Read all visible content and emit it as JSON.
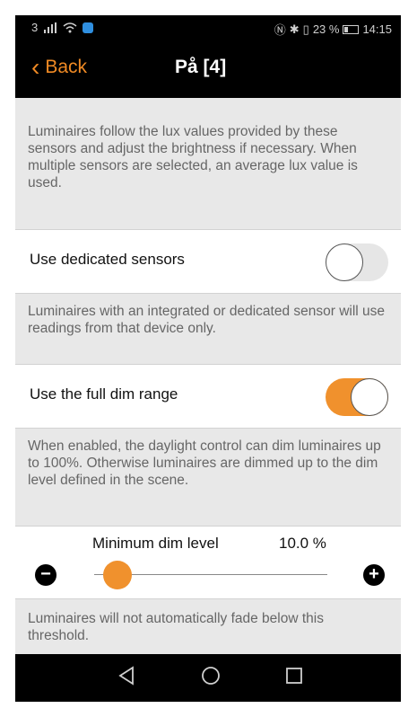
{
  "status": {
    "carrier": "3",
    "battery_text": "23 %",
    "time": "14:15"
  },
  "nav": {
    "back_label": "Back",
    "title": "På [4]"
  },
  "sensors_description": "Luminaires follow the lux values provided by these sensors and adjust the brightness if necessary. When multiple sensors are selected, an average lux value is used.",
  "dedicated_sensors": {
    "label": "Use dedicated sensors",
    "enabled": false
  },
  "dedicated_description": "Luminaires with an integrated or dedicated sensor will use readings from that device only.",
  "full_dim_range": {
    "label": "Use the full dim range",
    "enabled": true
  },
  "full_dim_description": "When enabled, the daylight control can dim luminaires up to 100%. Otherwise luminaires are dimmed up to the dim level defined in the scene.",
  "min_dim": {
    "label": "Minimum dim level",
    "value_text": "10.0 %",
    "value": 10.0,
    "min": 0,
    "max": 100
  },
  "min_dim_description": "Luminaires will not automatically fade below this threshold.",
  "colors": {
    "accent": "#f0912d",
    "background": "#e8e8e8"
  }
}
